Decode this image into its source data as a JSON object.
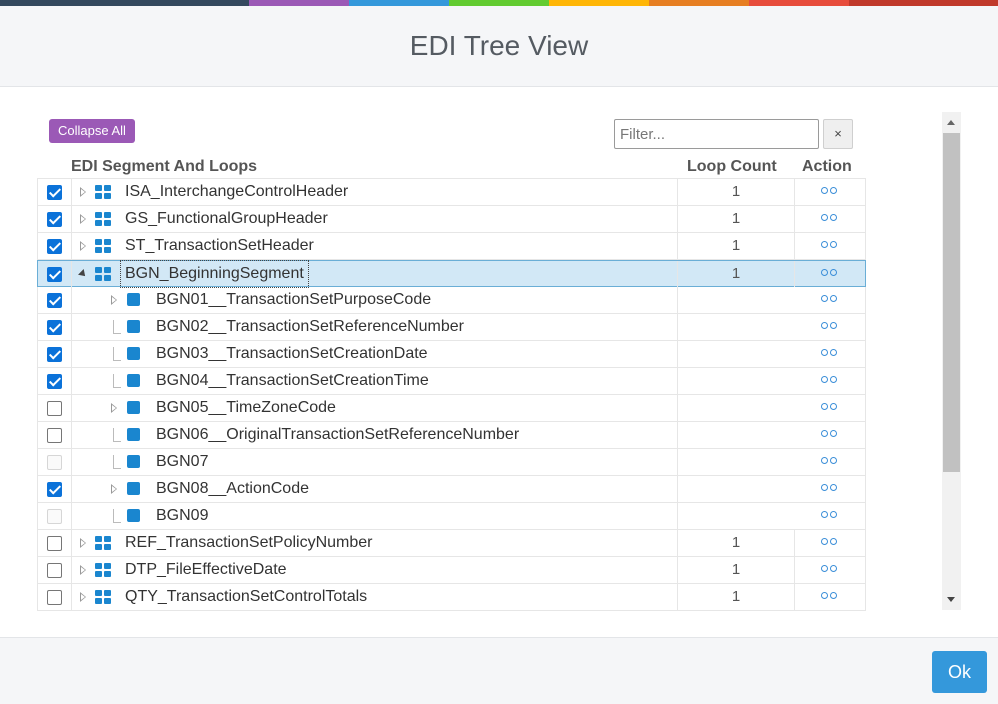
{
  "accent_colors": [
    "#34495e",
    "#9b59b6",
    "#3498db",
    "#62cb31",
    "#ffb606",
    "#e67e22",
    "#e74c3c",
    "#c0392b"
  ],
  "dialog": {
    "title": "EDI Tree View",
    "collapse_label": "Collapse All",
    "filter_placeholder": "Filter...",
    "clear_label": "×",
    "ok_label": "Ok"
  },
  "columns": {
    "name": "EDI Segment And Loops",
    "loop_count": "Loop Count",
    "action": "Action"
  },
  "rows": [
    {
      "label": "ISA_InterchangeControlHeader",
      "loop_count": "1",
      "checked": true,
      "level": 0,
      "expander": "right",
      "icon": "loop-icon"
    },
    {
      "label": "GS_FunctionalGroupHeader",
      "loop_count": "1",
      "checked": true,
      "level": 0,
      "expander": "right",
      "icon": "loop-icon"
    },
    {
      "label": "ST_TransactionSetHeader",
      "loop_count": "1",
      "checked": true,
      "level": 0,
      "expander": "right",
      "icon": "loop-icon"
    },
    {
      "label": "BGN_BeginningSegment",
      "loop_count": "1",
      "checked": true,
      "level": 0,
      "expander": "down",
      "icon": "loop-icon",
      "selected": true
    },
    {
      "label": "BGN01__TransactionSetPurposeCode",
      "loop_count": "",
      "checked": true,
      "level": 1,
      "expander": "right",
      "icon": "segment-icon"
    },
    {
      "label": "BGN02__TransactionSetReferenceNumber",
      "loop_count": "",
      "checked": true,
      "level": 1,
      "expander": "leaf",
      "icon": "segment-icon"
    },
    {
      "label": "BGN03__TransactionSetCreationDate",
      "loop_count": "",
      "checked": true,
      "level": 1,
      "expander": "leaf",
      "icon": "segment-icon"
    },
    {
      "label": "BGN04__TransactionSetCreationTime",
      "loop_count": "",
      "checked": true,
      "level": 1,
      "expander": "leaf",
      "icon": "segment-icon"
    },
    {
      "label": "BGN05__TimeZoneCode",
      "loop_count": "",
      "checked": false,
      "level": 1,
      "expander": "right",
      "icon": "segment-icon"
    },
    {
      "label": "BGN06__OriginalTransactionSetReferenceNumber",
      "loop_count": "",
      "checked": false,
      "level": 1,
      "expander": "leaf",
      "icon": "segment-icon"
    },
    {
      "label": "BGN07",
      "loop_count": "",
      "checked": false,
      "disabled": true,
      "level": 1,
      "expander": "leaf",
      "icon": "segment-icon"
    },
    {
      "label": "BGN08__ActionCode",
      "loop_count": "",
      "checked": true,
      "level": 1,
      "expander": "right",
      "icon": "segment-icon"
    },
    {
      "label": "BGN09",
      "loop_count": "",
      "checked": false,
      "disabled": true,
      "level": 1,
      "expander": "leaf",
      "icon": "segment-icon"
    },
    {
      "label": "REF_TransactionSetPolicyNumber",
      "loop_count": "1",
      "checked": false,
      "level": 0,
      "expander": "right",
      "icon": "loop-icon"
    },
    {
      "label": "DTP_FileEffectiveDate",
      "loop_count": "1",
      "checked": false,
      "level": 0,
      "expander": "right",
      "icon": "loop-icon"
    },
    {
      "label": "QTY_TransactionSetControlTotals",
      "loop_count": "1",
      "checked": false,
      "level": 0,
      "expander": "right",
      "icon": "loop-icon"
    }
  ]
}
